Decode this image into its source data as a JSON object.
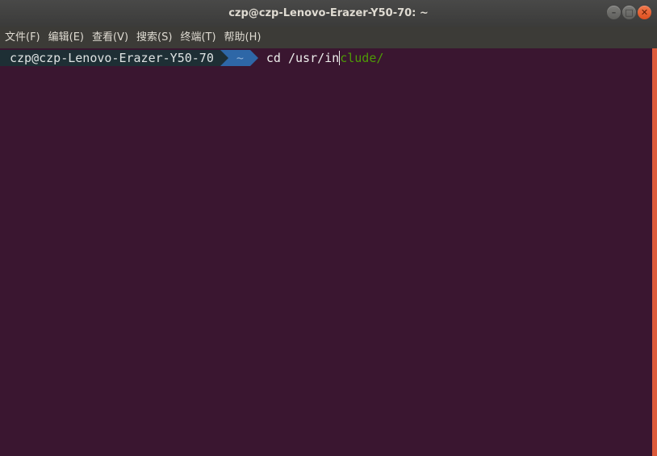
{
  "window": {
    "title": "czp@czp-Lenovo-Erazer-Y50-70: ~",
    "controls": {
      "minimize": "–",
      "maximize": "□",
      "close": "✕"
    }
  },
  "menu": {
    "items": [
      {
        "label": "文件(F)"
      },
      {
        "label": "编辑(E)"
      },
      {
        "label": "查看(V)"
      },
      {
        "label": "搜索(S)"
      },
      {
        "label": "终端(T)"
      },
      {
        "label": "帮助(H)"
      }
    ]
  },
  "terminal": {
    "prompt_user": "czp@czp-Lenovo-Erazer-Y50-70",
    "prompt_dir": "~",
    "typed": "cd /usr/in",
    "suggestion": "clude/"
  },
  "colors": {
    "terminal_bg": "#3a1630",
    "prompt_user_bg": "#1e2f35",
    "prompt_dir_bg": "#2e67a7",
    "suggestion_fg": "#4e9a06",
    "scrollbar_thumb": "#dd5a3a"
  }
}
